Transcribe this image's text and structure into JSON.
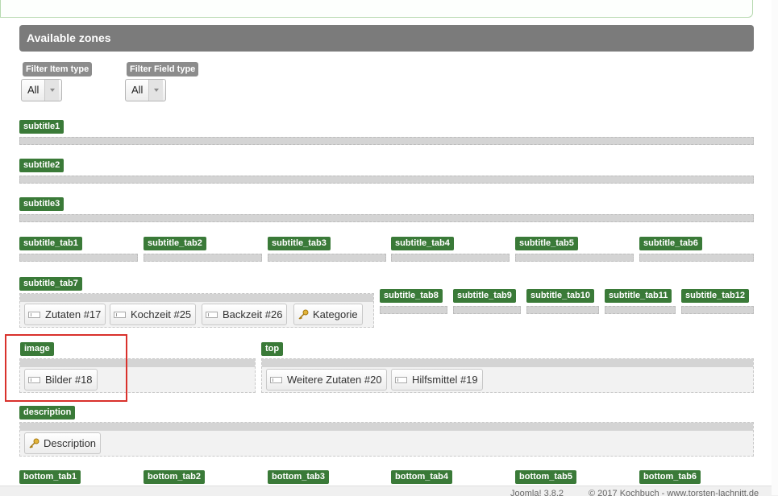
{
  "header": {
    "title": "Available zones"
  },
  "filters": [
    {
      "label": "Filter Item type",
      "value": "All"
    },
    {
      "label": "Filter Field type",
      "value": "All"
    }
  ],
  "zones": {
    "subtitle1": "subtitle1",
    "subtitle2": "subtitle2",
    "subtitle3": "subtitle3",
    "subtitle_tab1": "subtitle_tab1",
    "subtitle_tab2": "subtitle_tab2",
    "subtitle_tab3": "subtitle_tab3",
    "subtitle_tab4": "subtitle_tab4",
    "subtitle_tab5": "subtitle_tab5",
    "subtitle_tab6": "subtitle_tab6",
    "subtitle_tab7": "subtitle_tab7",
    "subtitle_tab8": "subtitle_tab8",
    "subtitle_tab9": "subtitle_tab9",
    "subtitle_tab10": "subtitle_tab10",
    "subtitle_tab11": "subtitle_tab11",
    "subtitle_tab12": "subtitle_tab12",
    "image": "image",
    "top": "top",
    "description": "description",
    "bottom_tab1": "bottom_tab1",
    "bottom_tab2": "bottom_tab2",
    "bottom_tab3": "bottom_tab3",
    "bottom_tab4": "bottom_tab4",
    "bottom_tab5": "bottom_tab5",
    "bottom_tab6": "bottom_tab6"
  },
  "items": {
    "tab7": [
      "Zutaten #17",
      "Kochzeit #25",
      "Backzeit #26",
      "Kategorie"
    ],
    "image": [
      "Bilder #18"
    ],
    "top": [
      "Weitere Zutaten #20",
      "Hilfsmittel #19"
    ],
    "description": [
      "Description"
    ]
  },
  "footer": {
    "version": "Joomla! 3.8.2",
    "copyright": "© 2017 Kochbuch - www.torsten-lachnitt.de"
  },
  "icons": {
    "field": "field-icon",
    "core": "key-icon"
  },
  "colors": {
    "zone_label": "#3a7a38",
    "header": "#7b7b7b",
    "highlight": "#d9312c"
  }
}
